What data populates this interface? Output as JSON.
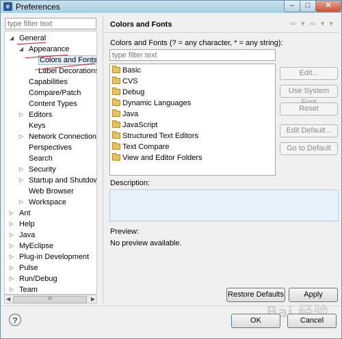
{
  "window": {
    "title": "Preferences"
  },
  "left": {
    "filter_placeholder": "type filter text",
    "tree": [
      {
        "label": "General",
        "depth": 0,
        "state": "open"
      },
      {
        "label": "Appearance",
        "depth": 1,
        "state": "open"
      },
      {
        "label": "Colors and Fonts",
        "depth": 2,
        "state": "leaf",
        "selected": true
      },
      {
        "label": "Label Decorations",
        "depth": 2,
        "state": "leaf"
      },
      {
        "label": "Capabilities",
        "depth": 1,
        "state": "leaf"
      },
      {
        "label": "Compare/Patch",
        "depth": 1,
        "state": "leaf"
      },
      {
        "label": "Content Types",
        "depth": 1,
        "state": "leaf"
      },
      {
        "label": "Editors",
        "depth": 1,
        "state": "closed"
      },
      {
        "label": "Keys",
        "depth": 1,
        "state": "leaf"
      },
      {
        "label": "Network Connections",
        "depth": 1,
        "state": "closed"
      },
      {
        "label": "Perspectives",
        "depth": 1,
        "state": "leaf"
      },
      {
        "label": "Search",
        "depth": 1,
        "state": "leaf"
      },
      {
        "label": "Security",
        "depth": 1,
        "state": "closed"
      },
      {
        "label": "Startup and Shutdown",
        "depth": 1,
        "state": "closed"
      },
      {
        "label": "Web Browser",
        "depth": 1,
        "state": "leaf"
      },
      {
        "label": "Workspace",
        "depth": 1,
        "state": "closed"
      },
      {
        "label": "Ant",
        "depth": 0,
        "state": "closed"
      },
      {
        "label": "Help",
        "depth": 0,
        "state": "closed"
      },
      {
        "label": "Java",
        "depth": 0,
        "state": "closed"
      },
      {
        "label": "MyEclipse",
        "depth": 0,
        "state": "closed"
      },
      {
        "label": "Plug-in Development",
        "depth": 0,
        "state": "closed"
      },
      {
        "label": "Pulse",
        "depth": 0,
        "state": "closed"
      },
      {
        "label": "Run/Debug",
        "depth": 0,
        "state": "closed"
      },
      {
        "label": "Team",
        "depth": 0,
        "state": "closed"
      }
    ],
    "scroll_thumb_label": "III"
  },
  "right": {
    "header_title": "Colors and Fonts",
    "nav_arrows": "⇦ ▾ ⇨ ▾ ▾",
    "description": "Colors and Fonts (? = any character, * = any string):",
    "filter_placeholder": "type filter text",
    "font_categories": [
      "Basic",
      "CVS",
      "Debug",
      "Dynamic Languages",
      "Java",
      "JavaScript",
      "Structured Text Editors",
      "Text Compare",
      "View and Editor Folders"
    ],
    "buttons": {
      "edit": "Edit...",
      "use_system_font": "Use System Font",
      "reset": "Reset",
      "edit_default": "Edit Default...",
      "go_to_default": "Go to Default"
    },
    "description_label": "Description:",
    "preview_label": "Preview:",
    "preview_text": "No preview available.",
    "restore_defaults": "Restore Defaults",
    "apply": "Apply"
  },
  "footer": {
    "ok": "OK",
    "cancel": "Cancel",
    "watermark": "Bai 经验"
  },
  "colors": {
    "annotation_red": "#d01818",
    "description_box": "#e8f2fa"
  }
}
